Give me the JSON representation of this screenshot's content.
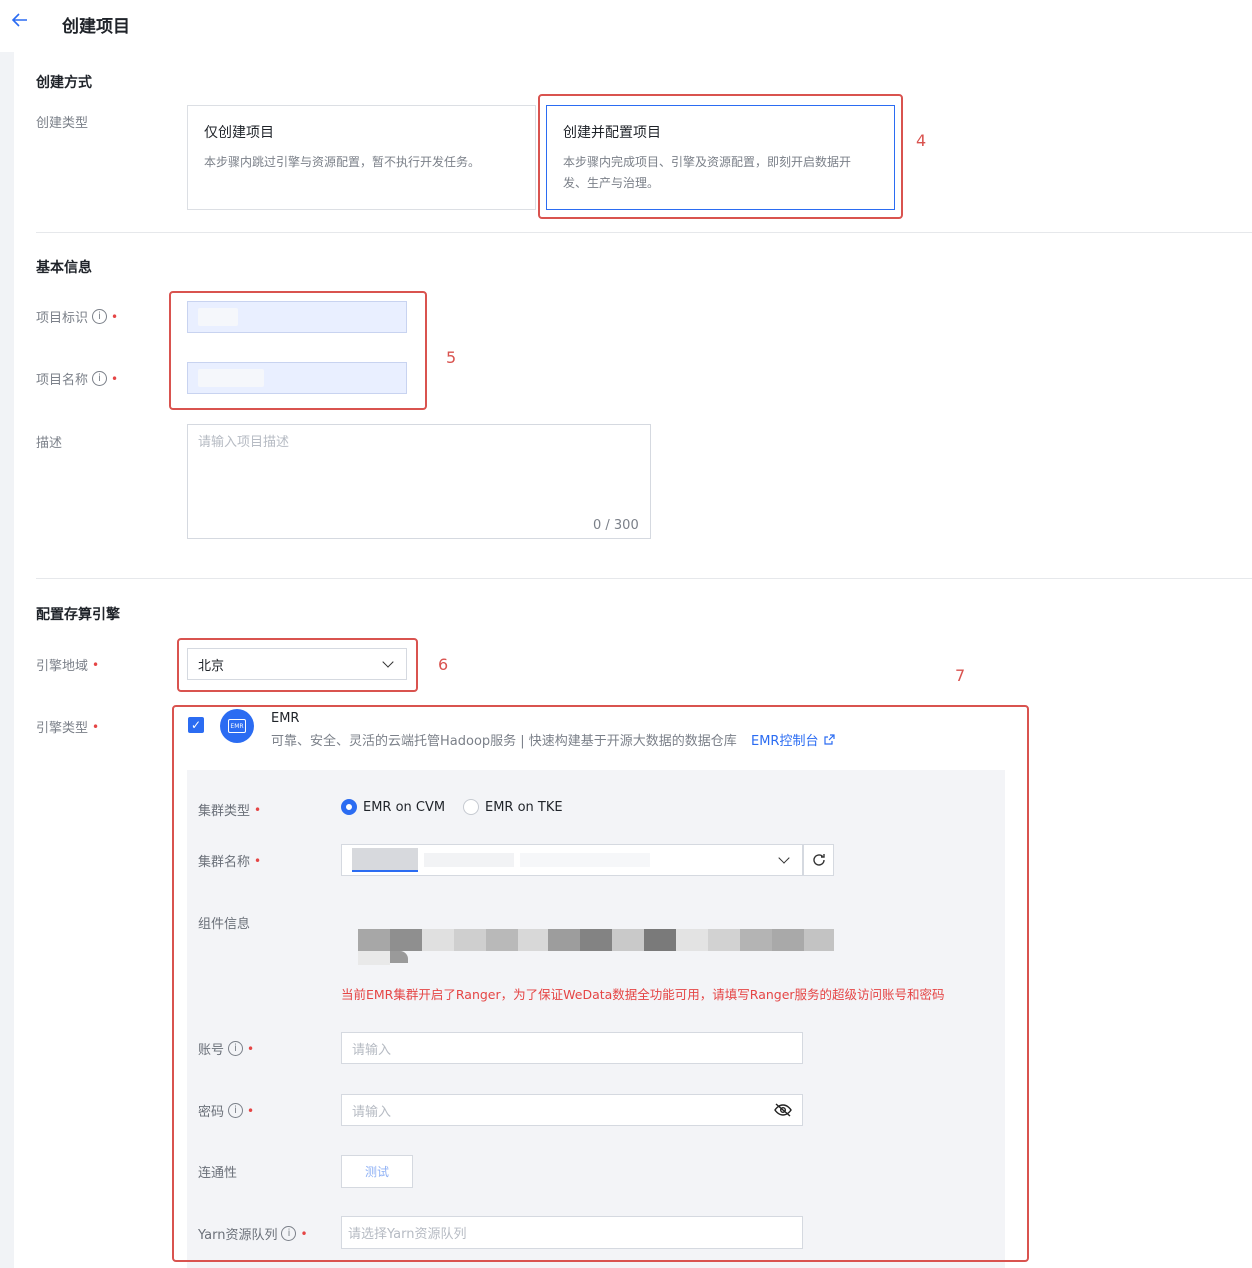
{
  "header": {
    "title": "创建项目",
    "back_icon": "arrow-left-icon"
  },
  "create_mode": {
    "section_title": "创建方式",
    "type_label": "创建类型",
    "options": [
      {
        "title": "仅创建项目",
        "desc": "本步骤内跳过引擎与资源配置，暂不执行开发任务。",
        "selected": false
      },
      {
        "title": "创建并配置项目",
        "desc": "本步骤内完成项目、引擎及资源配置，即刻开启数据开发、生产与治理。",
        "selected": true
      }
    ]
  },
  "basic_info": {
    "section_title": "基本信息",
    "id_label": "项目标识",
    "name_label": "项目名称",
    "desc_label": "描述",
    "desc_placeholder": "请输入项目描述",
    "desc_counter": "0 / 300"
  },
  "engine": {
    "section_title": "配置存算引擎",
    "region_label": "引擎地域",
    "region_value": "北京",
    "type_label": "引擎类型",
    "emr": {
      "name": "EMR",
      "logo_text": "EMR",
      "desc": "可靠、安全、灵活的云端托管Hadoop服务 | 快速构建基于开源大数据的数据仓库",
      "console_link": "EMR控制台",
      "checked": true
    },
    "cluster_type_label": "集群类型",
    "cluster_types": [
      {
        "label": "EMR on CVM",
        "selected": true
      },
      {
        "label": "EMR on TKE",
        "selected": false
      }
    ],
    "cluster_name_label": "集群名称",
    "component_label": "组件信息",
    "ranger_warning": "当前EMR集群开启了Ranger，为了保证WeData数据全功能可用，请填写Ranger服务的超级访问账号和密码",
    "account_label": "账号",
    "account_placeholder": "请输入",
    "password_label": "密码",
    "password_placeholder": "请输入",
    "connectivity_label": "连通性",
    "test_button": "测试",
    "yarn_label": "Yarn资源队列",
    "yarn_placeholder": "请选择Yarn资源队列"
  },
  "annotations": [
    "4",
    "5",
    "6",
    "7"
  ],
  "colors": {
    "accent": "#2b6cf2",
    "annotation": "#d9534f",
    "required": "#e54545"
  }
}
